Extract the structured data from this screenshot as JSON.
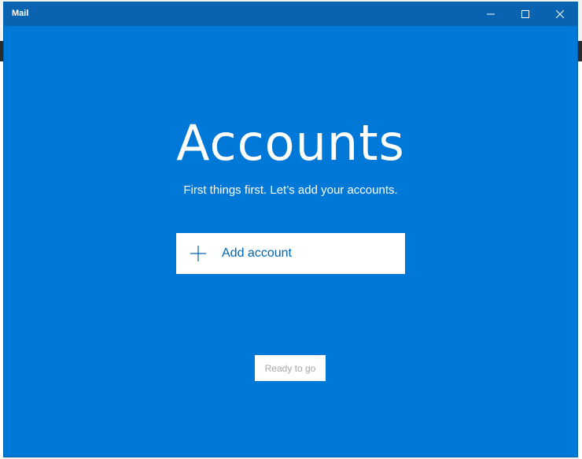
{
  "window": {
    "title": "Mail",
    "accent_color": "#0078d7",
    "titlebar_color": "#0a63b0"
  },
  "controls": {
    "minimize_icon": "minimize-icon",
    "maximize_icon": "maximize-icon",
    "close_icon": "close-icon"
  },
  "main": {
    "heading": "Accounts",
    "subheading": "First things first. Let’s add your accounts.",
    "add_account_label": "Add account",
    "add_account_icon": "plus-icon",
    "ready_label": "Ready to go"
  }
}
